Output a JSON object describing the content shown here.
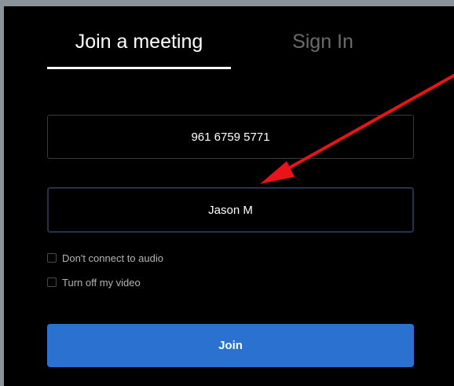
{
  "tabs": {
    "join_label": "Join a meeting",
    "signin_label": "Sign In"
  },
  "form": {
    "meeting_id_value": "961 6759 5771",
    "name_value": "Jason M"
  },
  "options": {
    "audio_label": "Don't connect to audio",
    "audio_checked": false,
    "video_label": "Turn off my video",
    "video_checked": false
  },
  "actions": {
    "join_label": "Join"
  },
  "colors": {
    "background": "#000000",
    "join_button": "#2a71d0",
    "annotation_arrow": "#e8141a"
  },
  "annotation": {
    "icon": "red-arrow-icon"
  }
}
